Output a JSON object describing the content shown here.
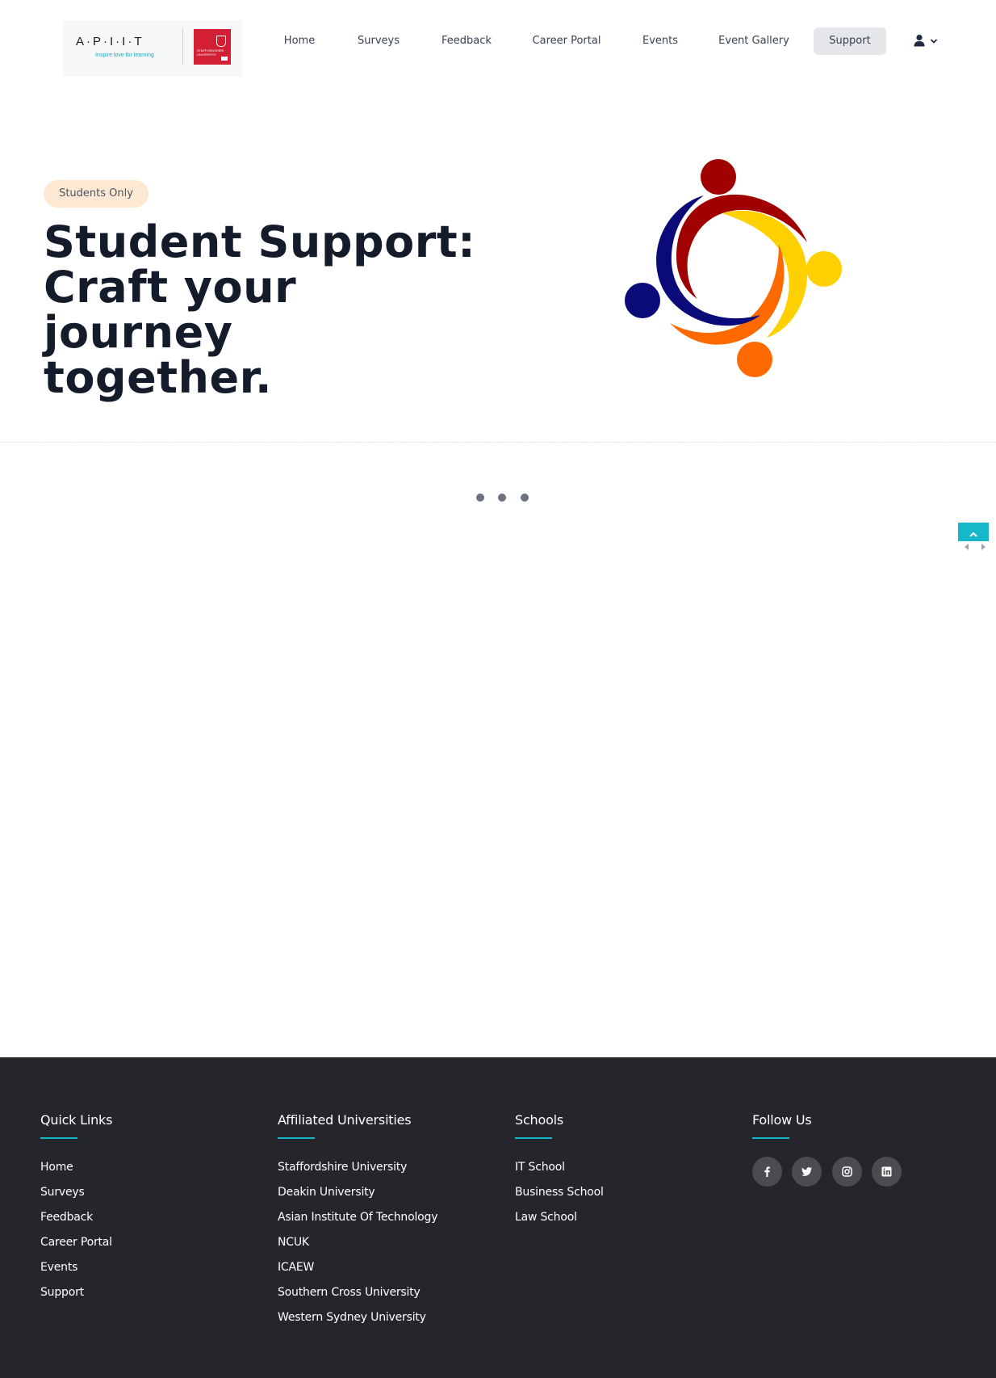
{
  "header": {
    "logo": {
      "brand": "A·P·I·I·T",
      "tagline": "Inspire love for learning",
      "partner_text": "STAFFORDSHIRE UNIVERSITY"
    },
    "nav": [
      {
        "label": "Home"
      },
      {
        "label": "Surveys"
      },
      {
        "label": "Feedback"
      },
      {
        "label": "Career Portal"
      },
      {
        "label": "Events"
      },
      {
        "label": "Event Gallery"
      },
      {
        "label": "Support",
        "active": true
      }
    ],
    "user_menu": {
      "icon": "user-icon",
      "chevron": "chevron-down-icon"
    }
  },
  "hero": {
    "badge": "Students Only",
    "title_lines": [
      "Student Support:",
      "Craft your journey",
      "together."
    ],
    "illustration": "community-circle-people",
    "illustration_colors": [
      "#a00000",
      "#ffd000",
      "#ff6a00",
      "#0a0a78"
    ]
  },
  "colors": {
    "accent": "#14b8c8",
    "footer_bg": "#25262b",
    "title": "#141c2b",
    "badge_bg": "#fde9d3"
  },
  "footer": {
    "quick_links": {
      "title": "Quick Links",
      "items": [
        "Home",
        "Surveys",
        "Feedback",
        "Career Portal",
        "Events",
        "Support"
      ]
    },
    "affiliated": {
      "title": "Affiliated Universities",
      "items": [
        "Staffordshire University",
        "Deakin University",
        "Asian Institute Of Technology",
        "NCUK",
        "ICAEW",
        "Southern Cross University",
        "Western Sydney University"
      ]
    },
    "schools": {
      "title": "Schools",
      "items": [
        "IT School",
        "Business School",
        "Law School"
      ]
    },
    "follow": {
      "title": "Follow Us",
      "icons": [
        "facebook-icon",
        "twitter-icon",
        "instagram-icon",
        "linkedin-icon"
      ]
    }
  }
}
